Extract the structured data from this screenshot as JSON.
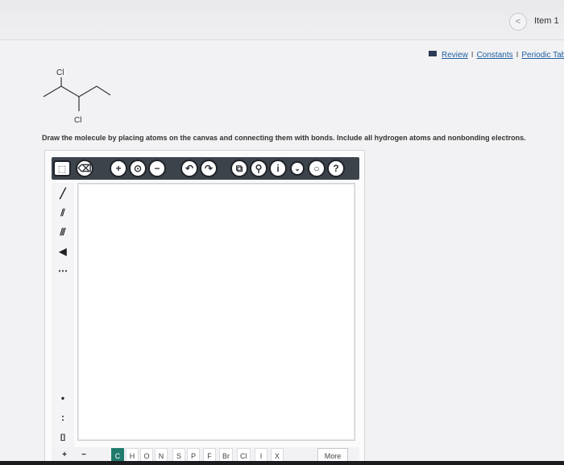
{
  "header": {
    "prev_icon": "chevron-left-icon",
    "prev_glyph": "<",
    "item_label": "Item 1"
  },
  "links": {
    "icon": "book-icon",
    "items": [
      "Review",
      "Constants",
      "Periodic Tabl"
    ],
    "separator": "I"
  },
  "molecule": {
    "top_atom": "Cl",
    "bottom_atom": "Cl"
  },
  "instructions": "Draw the molecule by placing atoms on the canvas and connecting them with bonds. Include all hydrogen atoms and nonbonding electrons.",
  "toolbar": {
    "buttons": [
      {
        "name": "lasso-select-icon",
        "glyph": "⬚"
      },
      {
        "name": "eraser-icon",
        "glyph": "⌫"
      },
      {
        "name": "zoom-in-icon",
        "glyph": "+"
      },
      {
        "name": "zoom-reset-icon",
        "glyph": "⊙"
      },
      {
        "name": "zoom-out-icon",
        "glyph": "−"
      },
      {
        "name": "undo-icon",
        "glyph": "↶"
      },
      {
        "name": "redo-icon",
        "glyph": "↷"
      },
      {
        "name": "copy-icon",
        "glyph": "⧉"
      },
      {
        "name": "template-icon",
        "glyph": "⚲"
      },
      {
        "name": "info-icon",
        "glyph": "i"
      },
      {
        "name": "expand-icon",
        "glyph": "⌄"
      },
      {
        "name": "search-icon",
        "glyph": "○"
      },
      {
        "name": "help-icon",
        "glyph": "?"
      }
    ]
  },
  "left_tools": [
    {
      "name": "single-bond-icon",
      "glyph": "╱"
    },
    {
      "name": "double-bond-icon",
      "glyph": "⫽"
    },
    {
      "name": "triple-bond-icon",
      "glyph": "⫻"
    },
    {
      "name": "wedge-bond-icon",
      "glyph": "◀"
    },
    {
      "name": "hash-bond-icon",
      "glyph": "⋯"
    },
    {
      "name": "radical-icon",
      "glyph": "•"
    },
    {
      "name": "lone-pair-icon",
      "glyph": ":"
    },
    {
      "name": "bracket-icon",
      "glyph": "[]"
    },
    {
      "name": "positive-charge-icon",
      "glyph": "+"
    },
    {
      "name": "negative-charge-icon",
      "glyph": "−"
    }
  ],
  "elements": [
    "C",
    "H",
    "O",
    "N",
    "S",
    "P",
    "F",
    "Br",
    "Cl",
    "I",
    "X"
  ],
  "more_label": "More",
  "colors": {
    "toolbar_bg": "#3c434b",
    "active_element": "#1f7a6c",
    "link": "#1f5fa0"
  }
}
